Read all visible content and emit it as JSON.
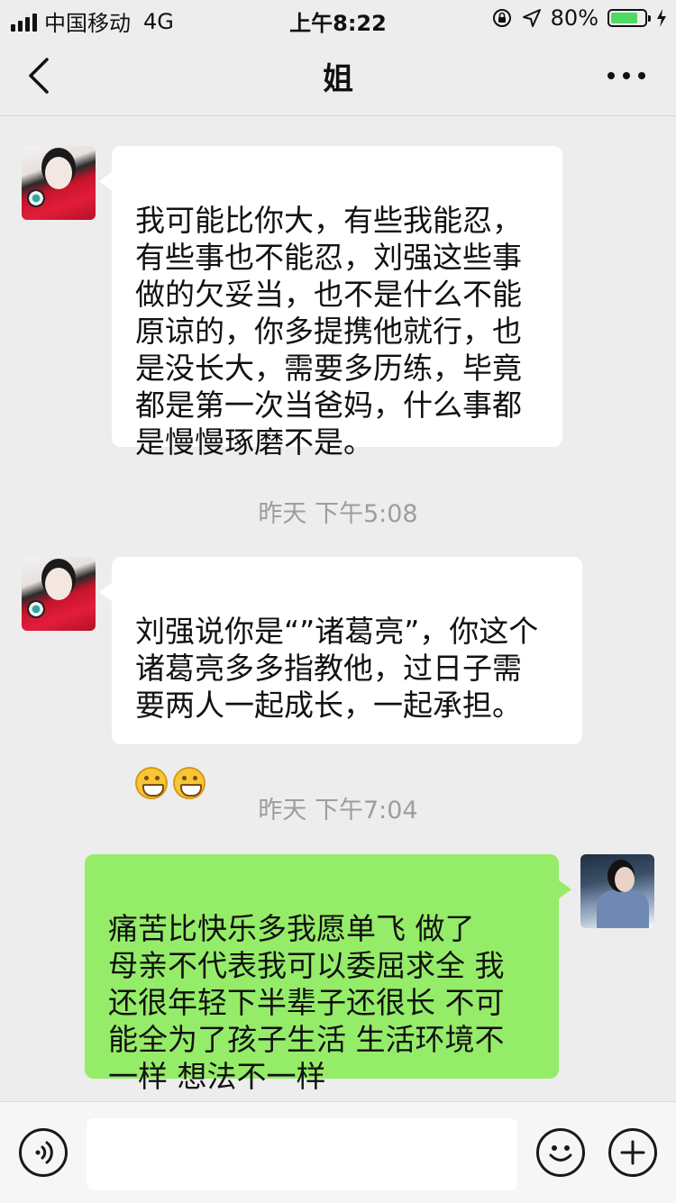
{
  "status_bar": {
    "carrier": "中国移动",
    "network": "4G",
    "time": "上午8:22",
    "battery_percent": "80%",
    "battery_level": 0.8,
    "icons": [
      "signal-icon",
      "orientation-lock-icon",
      "location-icon",
      "battery-icon",
      "charging-icon"
    ]
  },
  "nav": {
    "title": "姐",
    "back_icon": "chevron-left-icon",
    "more_icon": "more-dots-icon"
  },
  "messages": [
    {
      "sender": "sister",
      "text": "我可能比你大，有些我能忍，\n有些事也不能忍，刘强这些事\n做的欠妥当，也不是什么不能\n原谅的，你多提携他就行，也\n是没长大，需要多历练，毕竟\n都是第一次当爸妈，什么事都\n是慢慢琢磨不是。"
    },
    {
      "timestamp": "昨天 下午5:08"
    },
    {
      "sender": "sister",
      "text": "刘强说你是“”诸葛亮”，你这个\n诸葛亮多多指教他，过日子需\n要两人一起成长，一起承担。",
      "emoji": [
        "grin-emoji",
        "grin-emoji"
      ]
    },
    {
      "timestamp": "昨天 下午7:04"
    },
    {
      "sender": "me",
      "text": "痛苦比快乐多我愿单飞    做了\n母亲不代表我可以委屈求全  我\n还很年轻下半辈子还很长 不可\n能全为了孩子生活  生活环境不\n一样 想法不一样"
    }
  ],
  "input_bar": {
    "voice_icon": "voice-icon",
    "emoji_icon": "emoji-icon",
    "add_icon": "add-icon",
    "text_value": ""
  },
  "colors": {
    "background": "#ededed",
    "incoming_bubble": "#ffffff",
    "outgoing_bubble": "#95ec69",
    "timestamp": "#9d9d9d",
    "battery_fill": "#4cd964"
  }
}
